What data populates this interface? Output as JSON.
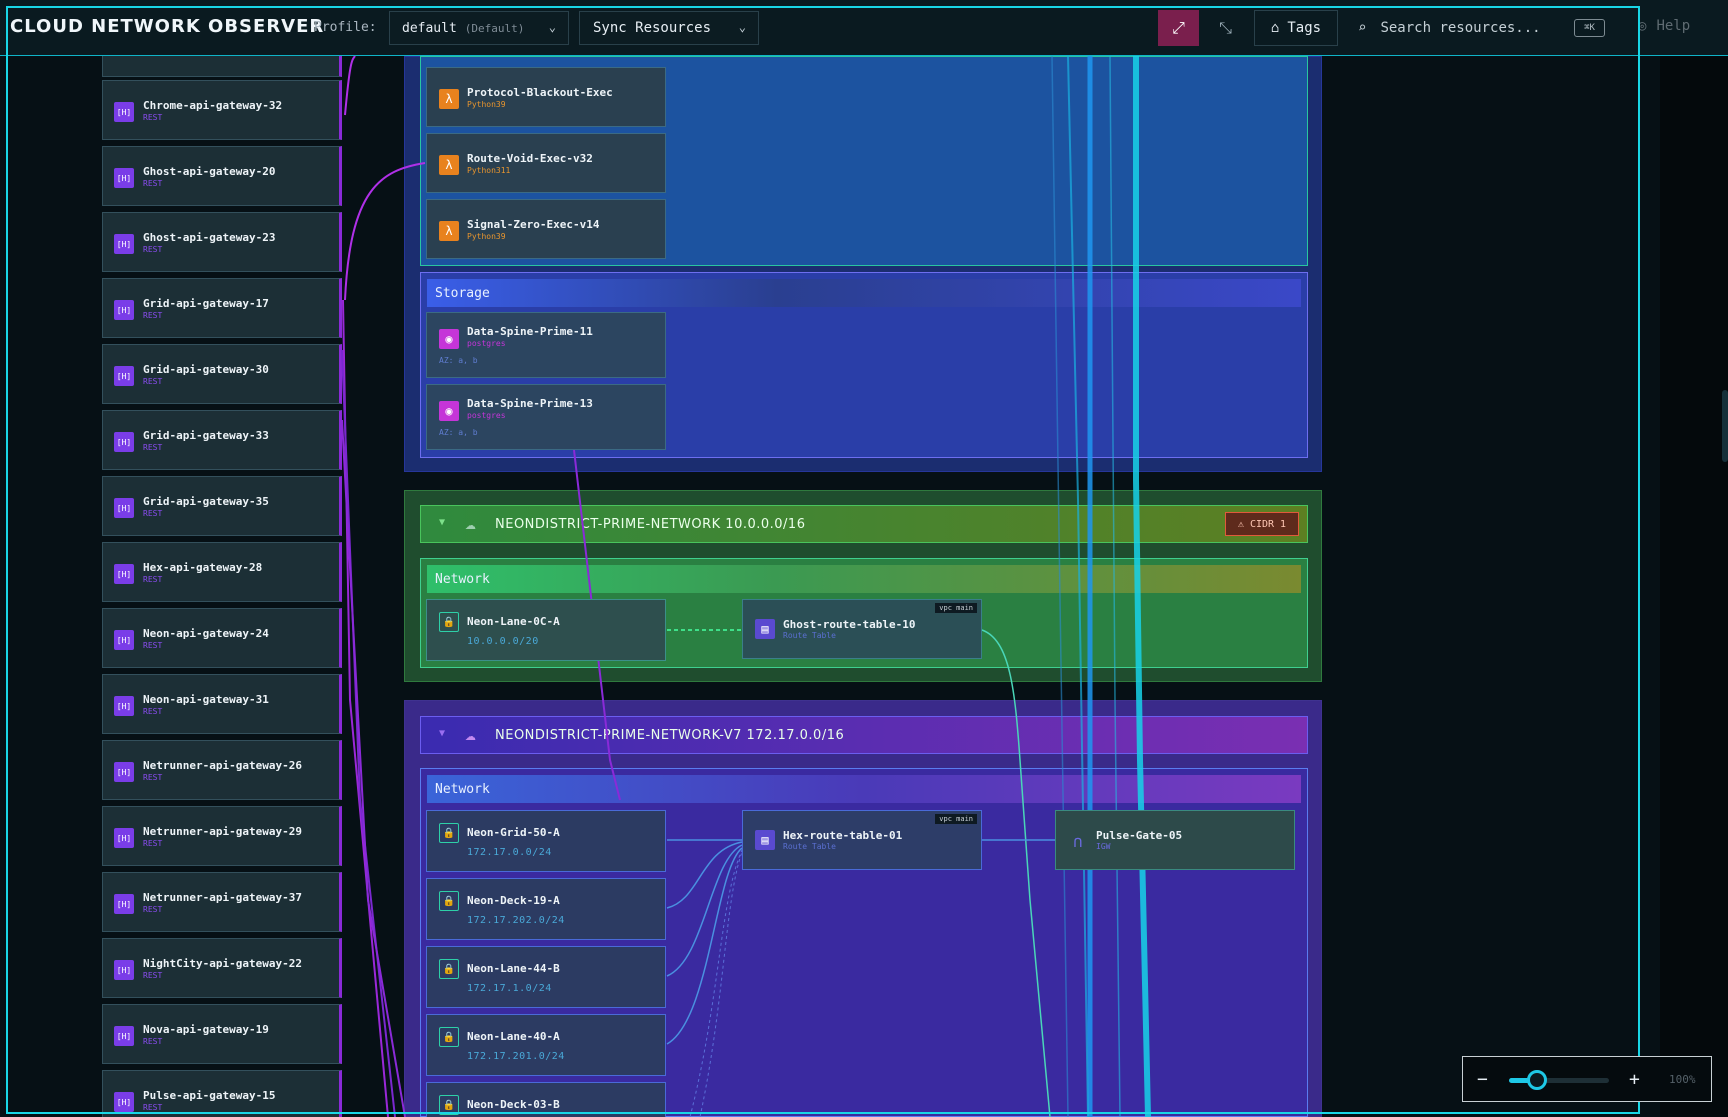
{
  "app": {
    "title": "CLOUD NETWORK OBSERVER"
  },
  "toolbar": {
    "profile_label": "Profile:",
    "profile_value": "default",
    "profile_hint": "(Default)",
    "sync_label": "Sync Resources",
    "tags_label": "Tags",
    "search_placeholder": "Search resources...",
    "search_shortcut": "⌘K",
    "help_label": "Help"
  },
  "colors": {
    "accent": "#19d6e6",
    "gateway": "#8a2ad8",
    "lambda": "#e8821e",
    "db": "#c535d8"
  },
  "gateways": [
    {
      "name": "Chrome-api-gateway-32",
      "type": "REST"
    },
    {
      "name": "Ghost-api-gateway-20",
      "type": "REST"
    },
    {
      "name": "Ghost-api-gateway-23",
      "type": "REST"
    },
    {
      "name": "Grid-api-gateway-17",
      "type": "REST"
    },
    {
      "name": "Grid-api-gateway-30",
      "type": "REST"
    },
    {
      "name": "Grid-api-gateway-33",
      "type": "REST"
    },
    {
      "name": "Grid-api-gateway-35",
      "type": "REST"
    },
    {
      "name": "Hex-api-gateway-28",
      "type": "REST"
    },
    {
      "name": "Neon-api-gateway-24",
      "type": "REST"
    },
    {
      "name": "Neon-api-gateway-31",
      "type": "REST"
    },
    {
      "name": "Netrunner-api-gateway-26",
      "type": "REST"
    },
    {
      "name": "Netrunner-api-gateway-29",
      "type": "REST"
    },
    {
      "name": "Netrunner-api-gateway-37",
      "type": "REST"
    },
    {
      "name": "NightCity-api-gateway-22",
      "type": "REST"
    },
    {
      "name": "Nova-api-gateway-19",
      "type": "REST"
    },
    {
      "name": "Pulse-api-gateway-15",
      "type": "REST"
    }
  ],
  "compute": [
    {
      "name": "Protocol-Blackout-Exec",
      "runtime": "Python39"
    },
    {
      "name": "Route-Void-Exec-v32",
      "runtime": "Python311"
    },
    {
      "name": "Signal-Zero-Exec-v14",
      "runtime": "Python39"
    }
  ],
  "storage": {
    "label": "Storage",
    "items": [
      {
        "name": "Data-Spine-Prime-11",
        "engine": "postgres",
        "az": "AZ: a, b"
      },
      {
        "name": "Data-Spine-Prime-13",
        "engine": "postgres",
        "az": "AZ: a, b"
      }
    ]
  },
  "vpc_prime": {
    "title": "NEONDISTRICT-PRIME-NETWORK 10.0.0.0/16",
    "badge": "CIDR 1",
    "section_label": "Network",
    "subnet": {
      "name": "Neon-Lane-0C-A",
      "cidr": "10.0.0.0/20"
    },
    "route_table": {
      "name": "Ghost-route-table-10",
      "type": "Route Table",
      "tag": "vpc main"
    }
  },
  "vpc_v7": {
    "title": "NEONDISTRICT-PRIME-NETWORK-V7 172.17.0.0/16",
    "section_label": "Network",
    "subnets": [
      {
        "name": "Neon-Grid-50-A",
        "cidr": "172.17.0.0/24"
      },
      {
        "name": "Neon-Deck-19-A",
        "cidr": "172.17.202.0/24"
      },
      {
        "name": "Neon-Lane-44-B",
        "cidr": "172.17.1.0/24"
      },
      {
        "name": "Neon-Lane-40-A",
        "cidr": "172.17.201.0/24"
      },
      {
        "name": "Neon-Deck-03-B",
        "cidr": ""
      }
    ],
    "route_table": {
      "name": "Hex-route-table-01",
      "type": "Route Table",
      "tag": "vpc main"
    },
    "igw": {
      "name": "Pulse-Gate-05",
      "type": "IGW"
    }
  },
  "zoom": {
    "level_label": "100%",
    "level": 0.28
  }
}
